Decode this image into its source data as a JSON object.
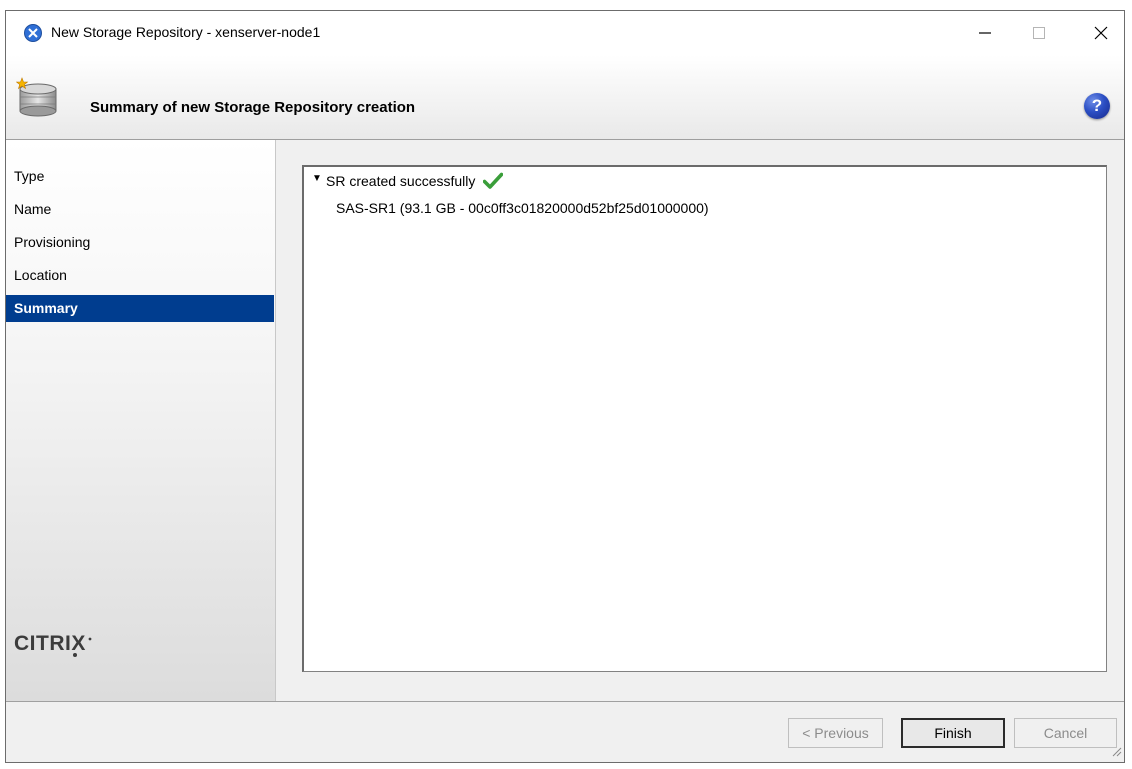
{
  "window": {
    "title": "New Storage Repository - xenserver-node1"
  },
  "header": {
    "title": "Summary of new Storage Repository creation",
    "help_symbol": "?"
  },
  "sidebar": {
    "items": [
      {
        "label": "Type",
        "selected": false
      },
      {
        "label": "Name",
        "selected": false
      },
      {
        "label": "Provisioning",
        "selected": false
      },
      {
        "label": "Location",
        "selected": false
      },
      {
        "label": "Summary",
        "selected": true
      }
    ],
    "brand": "CITRIX"
  },
  "summary": {
    "status_label": "SR created successfully",
    "sr_detail": "SAS-SR1 (93.1 GB - 00c0ff3c01820000d52bf25d01000000)",
    "expanded": true
  },
  "buttons": {
    "previous": "< Previous",
    "finish": "Finish",
    "cancel": "Cancel"
  },
  "colors": {
    "selection": "#003d8f",
    "success_check": "#3a9e3a",
    "help_icon": "#2c4fc4"
  },
  "icons": {
    "app": "xen-app-icon",
    "header": "storage-disk-icon",
    "help": "help-icon",
    "status": "checkmark-icon"
  }
}
